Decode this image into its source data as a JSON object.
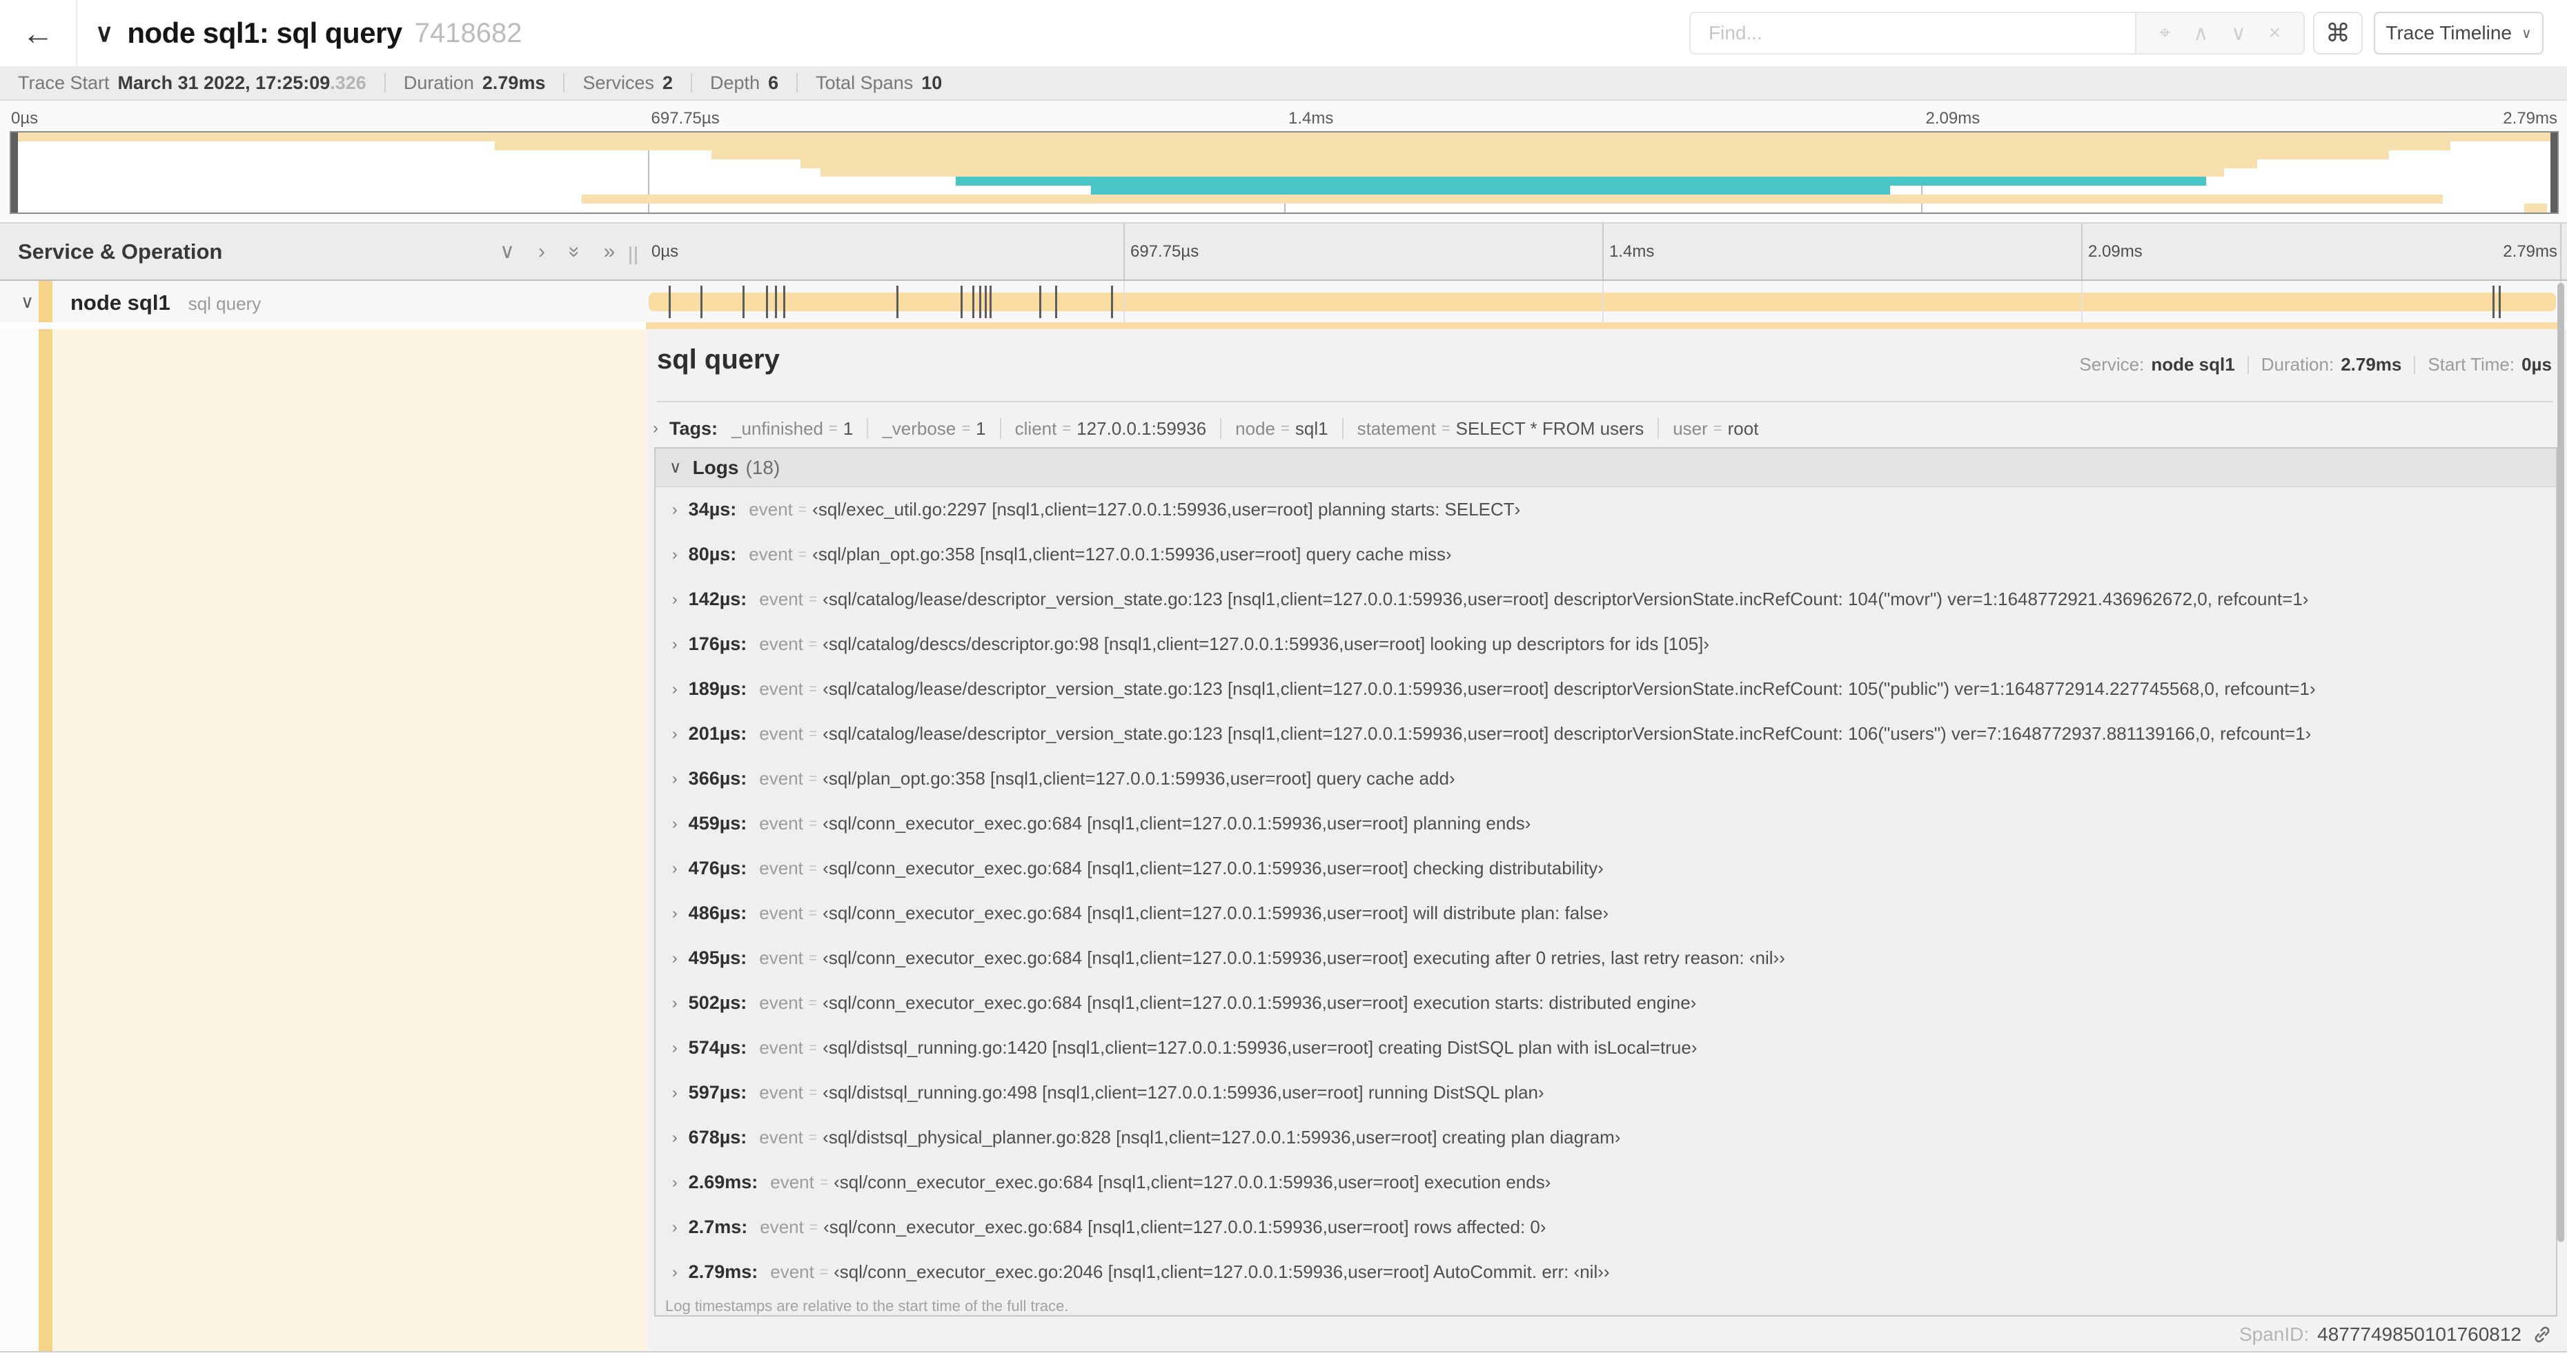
{
  "header": {
    "back_icon": "←",
    "collapse_icon": "∨",
    "title": "node sql1: sql query",
    "trace_id": "7418682",
    "find_placeholder": "Find...",
    "locate_icon": "⌖",
    "prev_icon": "∧",
    "next_icon": "∨",
    "clear_icon": "×",
    "cmd_icon": "⌘",
    "view_label": "Trace Timeline",
    "view_caret": "∨"
  },
  "summary": {
    "items": [
      {
        "label": "Trace Start",
        "value": "March 31 2022, 17:25:09",
        "suffix": ".326"
      },
      {
        "label": "Duration",
        "value": "2.79ms"
      },
      {
        "label": "Services",
        "value": "2"
      },
      {
        "label": "Depth",
        "value": "6"
      },
      {
        "label": "Total Spans",
        "value": "10"
      }
    ]
  },
  "time_ticks": [
    {
      "label": "0µs",
      "pct": 0
    },
    {
      "label": "697.75µs",
      "pct": 25
    },
    {
      "label": "1.4ms",
      "pct": 50
    },
    {
      "label": "2.09ms",
      "pct": 75
    },
    {
      "label": "2.79ms",
      "pct": 100
    }
  ],
  "minimap": {
    "spans": [
      {
        "row": 0,
        "start": 0,
        "end": 100,
        "color": "tan"
      },
      {
        "row": 1,
        "start": 19,
        "end": 95.8,
        "color": "tan"
      },
      {
        "row": 2,
        "start": 27.5,
        "end": 93.4,
        "color": "tan"
      },
      {
        "row": 3,
        "start": 31,
        "end": 88.2,
        "color": "tan"
      },
      {
        "row": 4,
        "start": 31.8,
        "end": 86.9,
        "color": "tan"
      },
      {
        "row": 5,
        "start": 37.1,
        "end": 86.2,
        "color": "teal"
      },
      {
        "row": 6,
        "start": 42.4,
        "end": 73.8,
        "color": "teal"
      },
      {
        "row": 7,
        "start": 22.4,
        "end": 95.5,
        "color": "tan"
      },
      {
        "row": 8,
        "start": 98.7,
        "end": 99.6,
        "color": "tan"
      }
    ]
  },
  "timeline": {
    "left_header": "Service & Operation",
    "collapse_all_icon": "∨",
    "expand_all_icon": "›",
    "collapse_one_icon": "»",
    "expand_one_icon": "»",
    "span_row": {
      "collapse_icon": "∨",
      "service": "node sql1",
      "operation": "sql query"
    }
  },
  "detail": {
    "title": "sql query",
    "meta": [
      {
        "label": "Service:",
        "value": "node sql1"
      },
      {
        "label": "Duration:",
        "value": "2.79ms"
      },
      {
        "label": "Start Time:",
        "value": "0µs"
      }
    ],
    "tags_chevron": "›",
    "tags_label": "Tags:",
    "tags": [
      {
        "key": "_unfinished",
        "value": "1"
      },
      {
        "key": "_verbose",
        "value": "1"
      },
      {
        "key": "client",
        "value": "127.0.0.1:59936"
      },
      {
        "key": "node",
        "value": "sql1"
      },
      {
        "key": "statement",
        "value": "SELECT * FROM users"
      },
      {
        "key": "user",
        "value": "root"
      }
    ],
    "logs_chevron": "∨",
    "logs_label": "Logs",
    "logs_count": "(18)",
    "log_key": "event",
    "logs": [
      {
        "time": "34µs:",
        "pct": 1.22,
        "value": "‹sql/exec_util.go:2297 [nsql1,client=127.0.0.1:59936,user=root] planning starts: SELECT›"
      },
      {
        "time": "80µs:",
        "pct": 2.87,
        "value": "‹sql/plan_opt.go:358 [nsql1,client=127.0.0.1:59936,user=root] query cache miss›"
      },
      {
        "time": "142µs:",
        "pct": 5.09,
        "value": "‹sql/catalog/lease/descriptor_version_state.go:123 [nsql1,client=127.0.0.1:59936,user=root] descriptorVersionState.incRefCount: 104(\"movr\") ver=1:1648772921.436962672,0, refcount=1›"
      },
      {
        "time": "176µs:",
        "pct": 6.31,
        "value": "‹sql/catalog/descs/descriptor.go:98 [nsql1,client=127.0.0.1:59936,user=root] looking up descriptors for ids [105]›"
      },
      {
        "time": "189µs:",
        "pct": 6.77,
        "value": "‹sql/catalog/lease/descriptor_version_state.go:123 [nsql1,client=127.0.0.1:59936,user=root] descriptorVersionState.incRefCount: 105(\"public\") ver=1:1648772914.227745568,0, refcount=1›"
      },
      {
        "time": "201µs:",
        "pct": 7.2,
        "value": "‹sql/catalog/lease/descriptor_version_state.go:123 [nsql1,client=127.0.0.1:59936,user=root] descriptorVersionState.incRefCount: 106(\"users\") ver=7:1648772937.881139166,0, refcount=1›"
      },
      {
        "time": "366µs:",
        "pct": 13.12,
        "value": "‹sql/plan_opt.go:358 [nsql1,client=127.0.0.1:59936,user=root] query cache add›"
      },
      {
        "time": "459µs:",
        "pct": 16.45,
        "value": "‹sql/conn_executor_exec.go:684 [nsql1,client=127.0.0.1:59936,user=root] planning ends›"
      },
      {
        "time": "476µs:",
        "pct": 17.06,
        "value": "‹sql/conn_executor_exec.go:684 [nsql1,client=127.0.0.1:59936,user=root] checking distributability›"
      },
      {
        "time": "486µs:",
        "pct": 17.42,
        "value": "‹sql/conn_executor_exec.go:684 [nsql1,client=127.0.0.1:59936,user=root] will distribute plan: false›"
      },
      {
        "time": "495µs:",
        "pct": 17.74,
        "value": "‹sql/conn_executor_exec.go:684 [nsql1,client=127.0.0.1:59936,user=root] executing after 0 retries, last retry reason: ‹nil››"
      },
      {
        "time": "502µs:",
        "pct": 17.99,
        "value": "‹sql/conn_executor_exec.go:684 [nsql1,client=127.0.0.1:59936,user=root] execution starts: distributed engine›"
      },
      {
        "time": "574µs:",
        "pct": 20.57,
        "value": "‹sql/distsql_running.go:1420 [nsql1,client=127.0.0.1:59936,user=root] creating DistSQL plan with isLocal=true›"
      },
      {
        "time": "597µs:",
        "pct": 21.4,
        "value": "‹sql/distsql_running.go:498 [nsql1,client=127.0.0.1:59936,user=root] running DistSQL plan›"
      },
      {
        "time": "678µs:",
        "pct": 24.3,
        "value": "‹sql/distsql_physical_planner.go:828 [nsql1,client=127.0.0.1:59936,user=root] creating plan diagram›"
      },
      {
        "time": "2.69ms:",
        "pct": 96.42,
        "value": "‹sql/conn_executor_exec.go:684 [nsql1,client=127.0.0.1:59936,user=root] execution ends›"
      },
      {
        "time": "2.7ms:",
        "pct": 96.77,
        "value": "‹sql/conn_executor_exec.go:684 [nsql1,client=127.0.0.1:59936,user=root] rows affected: 0›"
      },
      {
        "time": "2.79ms:",
        "pct": 100,
        "value": "‹sql/conn_executor_exec.go:2046 [nsql1,client=127.0.0.1:59936,user=root] AutoCommit. err: ‹nil››"
      }
    ],
    "logs_note": "Log timestamps are relative to the start time of the full trace.",
    "spanid_label": "SpanID:",
    "spanid_value": "4877749850101760812"
  },
  "colors": {
    "span_bar": "#f8dca1",
    "minimap_tan": "#f8dfae",
    "teal": "#48c5c5",
    "accent": "#f5d489",
    "cream": "#fdf5e3"
  }
}
